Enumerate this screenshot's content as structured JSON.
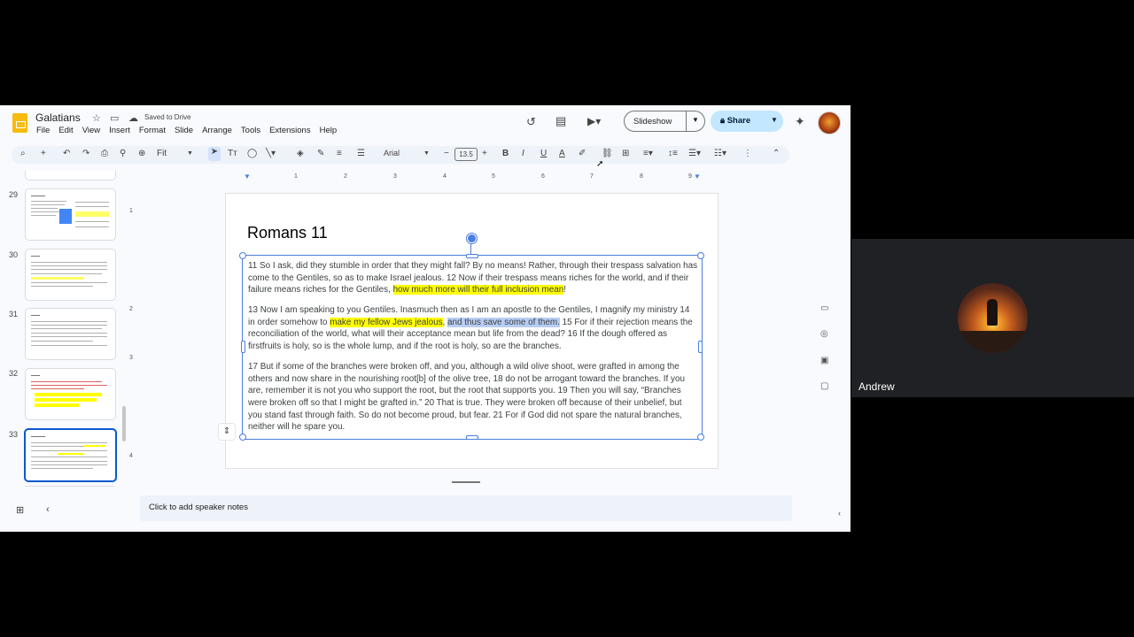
{
  "app": {
    "doc_title": "Galatians",
    "saved_status": "Saved to Drive",
    "menu": [
      "File",
      "Edit",
      "View",
      "Insert",
      "Format",
      "Slide",
      "Arrange",
      "Tools",
      "Extensions",
      "Help"
    ],
    "slideshow_label": "Slideshow",
    "share_label": "Share"
  },
  "toolbar": {
    "zoom": "Fit",
    "font": "Arial",
    "font_size": "13.5"
  },
  "filmstrip": {
    "slide_numbers": [
      "29",
      "30",
      "31",
      "32",
      "33"
    ],
    "selected": "33"
  },
  "ruler": {
    "h_ticks": [
      "1",
      "2",
      "3",
      "4",
      "5",
      "6",
      "7",
      "8",
      "9"
    ],
    "v_ticks": [
      "1",
      "2",
      "3",
      "4"
    ]
  },
  "slide": {
    "title": "Romans 11",
    "p1_a": "11 So I ask, did they stumble in order that they might fall? By no means! Rather, through their trespass salvation has come to the Gentiles, so as to make Israel jealous. 12 Now if their trespass means riches for the world, and if their failure means riches for the Gentiles, ",
    "p1_hl": "how much more will their full inclusion mean",
    "p1_b": "!",
    "p2_a": "13 Now I am speaking to you Gentiles. Inasmuch then as I am an apostle to the Gentiles, I magnify my ministry 14 in order somehow to ",
    "p2_hl": "make my fellow Jews jealous",
    "p2_sep": ", ",
    "p2_sel": "and thus save some of them.",
    "p2_b": " 15 For if their rejection means the reconciliation of the world, what will their acceptance mean but life from the dead? 16 If the dough offered as firstfruits is holy, so is the whole lump, and if the root is holy, so are the branches.",
    "p3": "17 But if some of the branches were broken off, and you, although a wild olive shoot, were grafted in among the others and now share in the nourishing root[b] of the olive tree, 18 do not be arrogant toward the branches. If you are, remember it is not you who support the root, but the root that supports you. 19 Then you will say, “Branches were broken off so that I might be grafted in.” 20 That is true. They were broken off because of their unbelief, but you stand fast through faith. So do not become proud, but fear. 21 For if God did not spare the natural branches, neither will he spare you."
  },
  "notes_placeholder": "Click to add speaker notes",
  "participant": {
    "name": "Andrew"
  },
  "colors": {
    "highlight": "#ffff00",
    "selection": "#b8cdf4",
    "accent": "#0b57d0",
    "share_bg": "#c2e7ff"
  }
}
